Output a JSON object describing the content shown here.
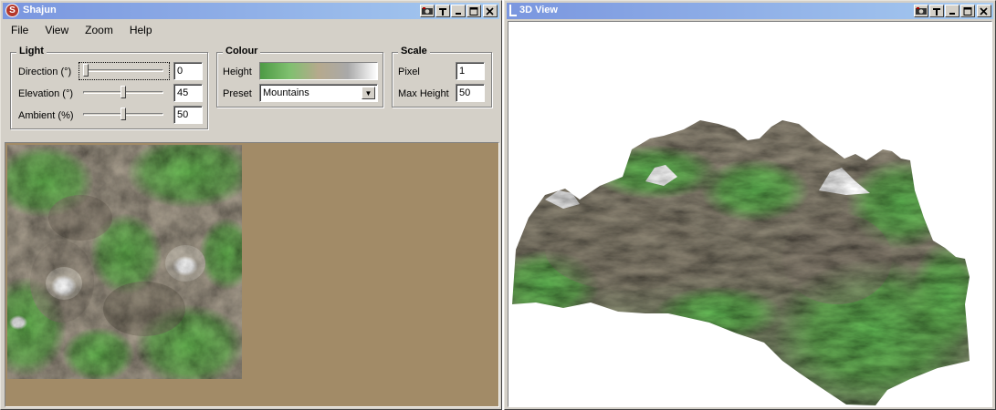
{
  "main_window": {
    "title": "Shajun",
    "app_icon": "s-logo-icon",
    "menu": [
      "File",
      "View",
      "Zoom",
      "Help"
    ],
    "light": {
      "group_label": "Light",
      "direction_label": "Direction (°)",
      "direction_value": "0",
      "direction_level": 0.0,
      "elevation_label": "Elevation (°)",
      "elevation_value": "45",
      "elevation_level": 0.5,
      "ambient_label": "Ambient (%)",
      "ambient_value": "50",
      "ambient_level": 0.5
    },
    "colour": {
      "group_label": "Colour",
      "height_label": "Height",
      "gradient_colors": [
        "#4d9a44",
        "#7fc06f",
        "#b6a98d",
        "#a9a9a9",
        "#ffffff"
      ],
      "preset_label": "Preset",
      "preset_value": "Mountains"
    },
    "scale": {
      "group_label": "Scale",
      "pixel_label": "Pixel",
      "pixel_value": "1",
      "max_height_label": "Max Height",
      "max_height_value": "50"
    },
    "canvas_background": "#a28b67"
  },
  "view3d_window": {
    "title": "3D View",
    "background": "#ffffff"
  },
  "colors": {
    "grass": "#5ea44d",
    "rock": "#8e8676",
    "dark_rock": "#5f594f",
    "snow": "#f4f4f4"
  }
}
